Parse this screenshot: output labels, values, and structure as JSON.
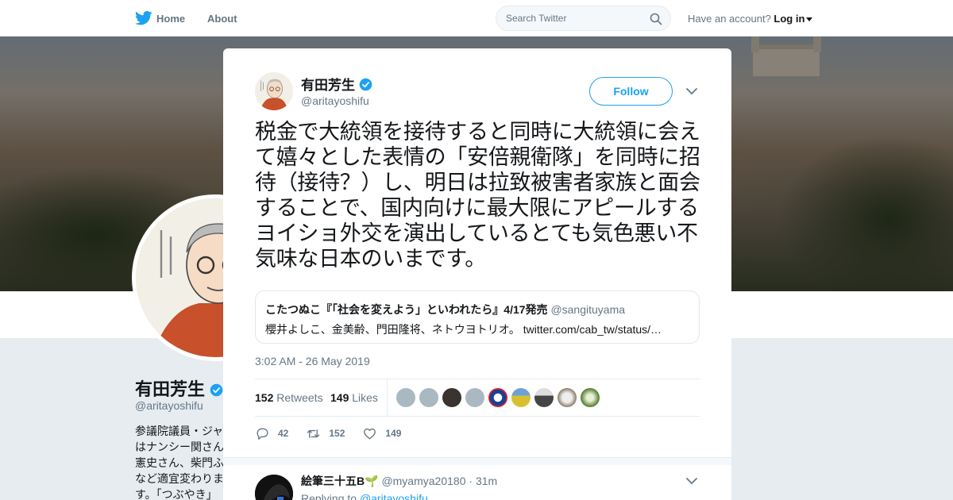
{
  "nav": {
    "home": "Home",
    "about": "About",
    "search_placeholder": "Search Twitter",
    "account_prompt": "Have an account?",
    "login": "Log in"
  },
  "profile": {
    "name": "有田芳生",
    "handle": "@aritayoshifu",
    "bio": "参議院議員・ジャ\nはナンシー関さん\n憲史さん、柴門ふ\nなど適宜変わりま\nす。「つぶやき」"
  },
  "tweet": {
    "author_name": "有田芳生",
    "author_handle": "@aritayoshifu",
    "follow_label": "Follow",
    "text": "税金で大統領を接待すると同時に大統領に会えて嬉々とした表情の「安倍親衛隊」を同時に招待（接待？）し、明日は拉致被害者家族と面会することで、国内向けに最大限にアピールするヨイショ外交を演出しているとても気色悪い不気味な日本のいまです。",
    "quote": {
      "name": "こたつぬこ『「社会を変えよう」といわれたら』4/17発売",
      "handle": "@sangituyama",
      "text": "櫻井よしこ、金美齢、門田隆将、ネトウヨトリオ。 twitter.com/cab_tw/status/…"
    },
    "timestamp": "3:02 AM - 26 May 2019",
    "retweets_count": "152",
    "retweets_label": "Retweets",
    "likes_count": "149",
    "likes_label": "Likes",
    "actions": {
      "replies": "42",
      "retweets": "152",
      "likes": "149"
    }
  },
  "reply": {
    "name": "絵筆三十五B🌱",
    "handle": "@myamya20180",
    "sep": "·",
    "time": "31m",
    "replying_to": "Replying to",
    "replying_mention": "@aritayoshifu"
  },
  "colors": {
    "accent": "#1da1f2",
    "text_secondary": "#657786"
  },
  "icons": [
    "twitter-bird-icon",
    "search-icon",
    "close-icon",
    "verified-badge-icon",
    "chevron-down-icon",
    "reply-icon",
    "retweet-icon",
    "heart-icon"
  ]
}
